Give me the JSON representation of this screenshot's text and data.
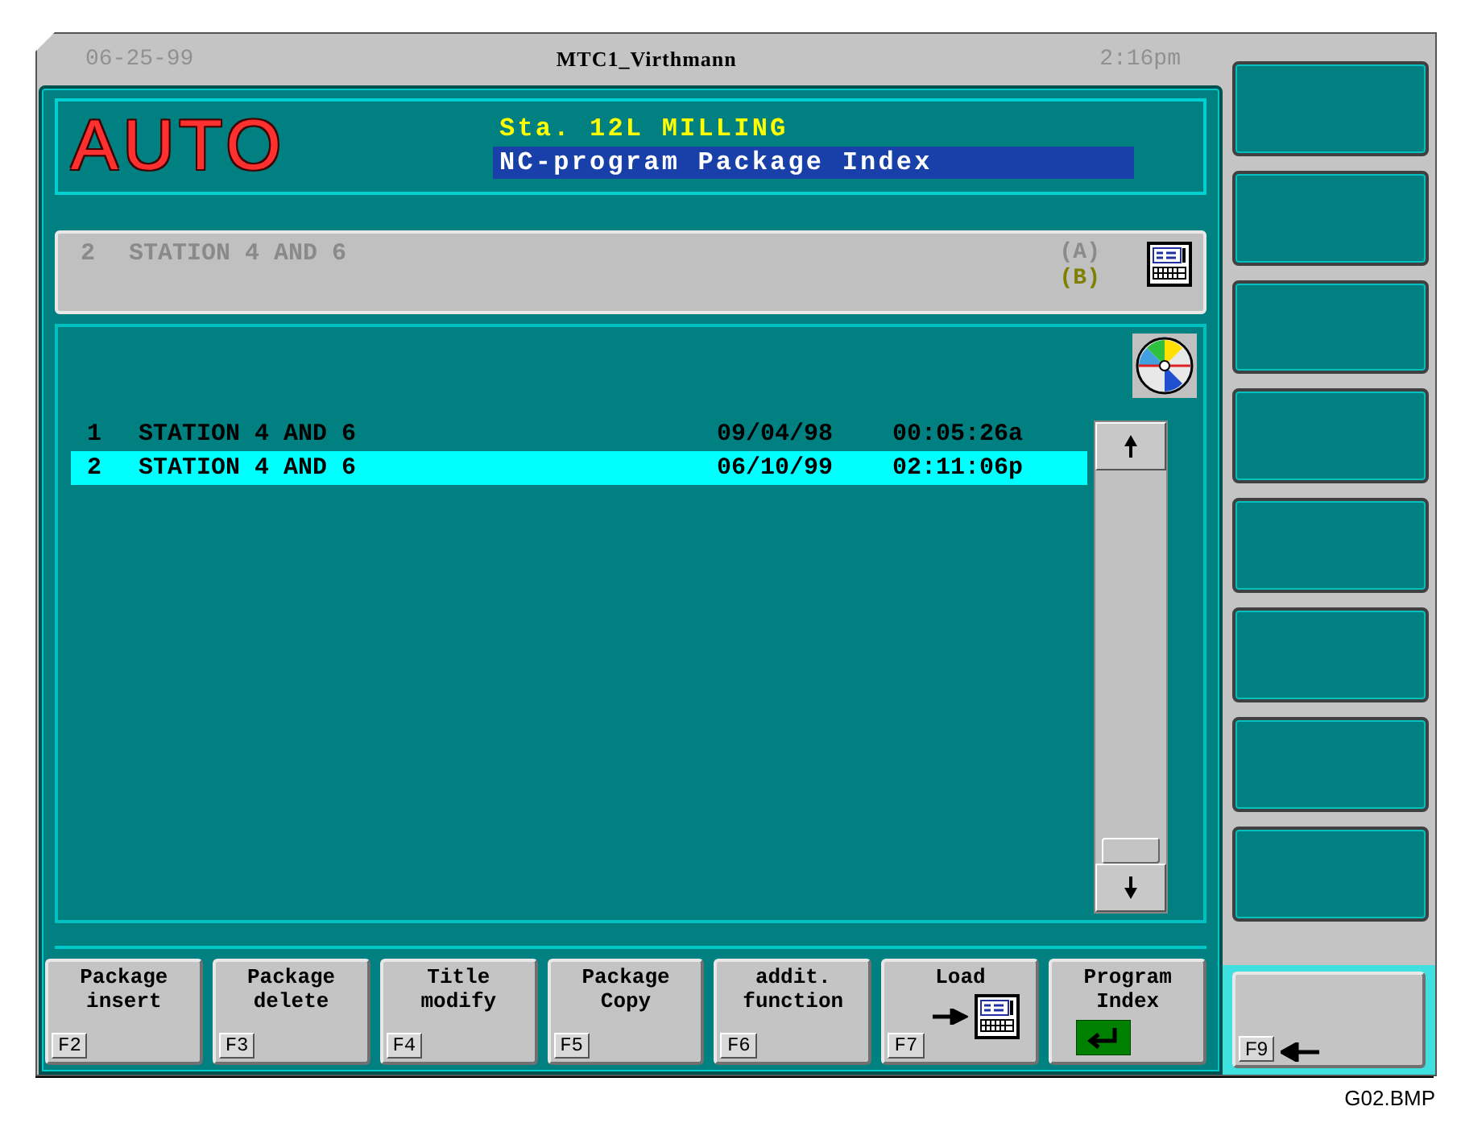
{
  "header": {
    "date": "06-25-99",
    "title": "MTC1_Virthmann",
    "time": "2:16pm"
  },
  "mode": "AUTO",
  "station": "Sta. 12L MILLING",
  "screen_title": "NC-program Package Index",
  "current": {
    "number": "2",
    "name": "STATION 4 AND 6",
    "slots": [
      {
        "label": "(A)",
        "selected": false
      },
      {
        "label": "(B)",
        "selected": true
      }
    ]
  },
  "rows": [
    {
      "number": "1",
      "name": "STATION 4 AND 6",
      "date": "09/04/98",
      "time": "00:05:26a",
      "selected": false
    },
    {
      "number": "2",
      "name": "STATION 4 AND 6",
      "date": "06/10/99",
      "time": "02:11:06p",
      "selected": true
    }
  ],
  "side_keys": [
    {
      "kind": "blank"
    },
    {
      "kind": "blank"
    },
    {
      "kind": "blank"
    },
    {
      "kind": "blank"
    },
    {
      "kind": "blank"
    },
    {
      "kind": "blank"
    },
    {
      "kind": "blank"
    },
    {
      "kind": "blank"
    }
  ],
  "softkeys": [
    {
      "kind": "text",
      "lines": [
        "Package",
        "insert"
      ],
      "key": "F2"
    },
    {
      "kind": "text",
      "lines": [
        "Package",
        "delete"
      ],
      "key": "F3"
    },
    {
      "kind": "text",
      "lines": [
        "Title",
        "modify"
      ],
      "key": "F4"
    },
    {
      "kind": "text",
      "lines": [
        "Package",
        "Copy"
      ],
      "key": "F5"
    },
    {
      "kind": "text",
      "lines": [
        "addit.",
        "function"
      ],
      "key": "F6"
    },
    {
      "kind": "load",
      "lines": [
        "Load"
      ],
      "key": "F7"
    },
    {
      "kind": "enter",
      "lines": [
        "Program",
        "Index"
      ]
    }
  ],
  "back_key": {
    "key": "F9"
  },
  "caption": "G02.BMP"
}
